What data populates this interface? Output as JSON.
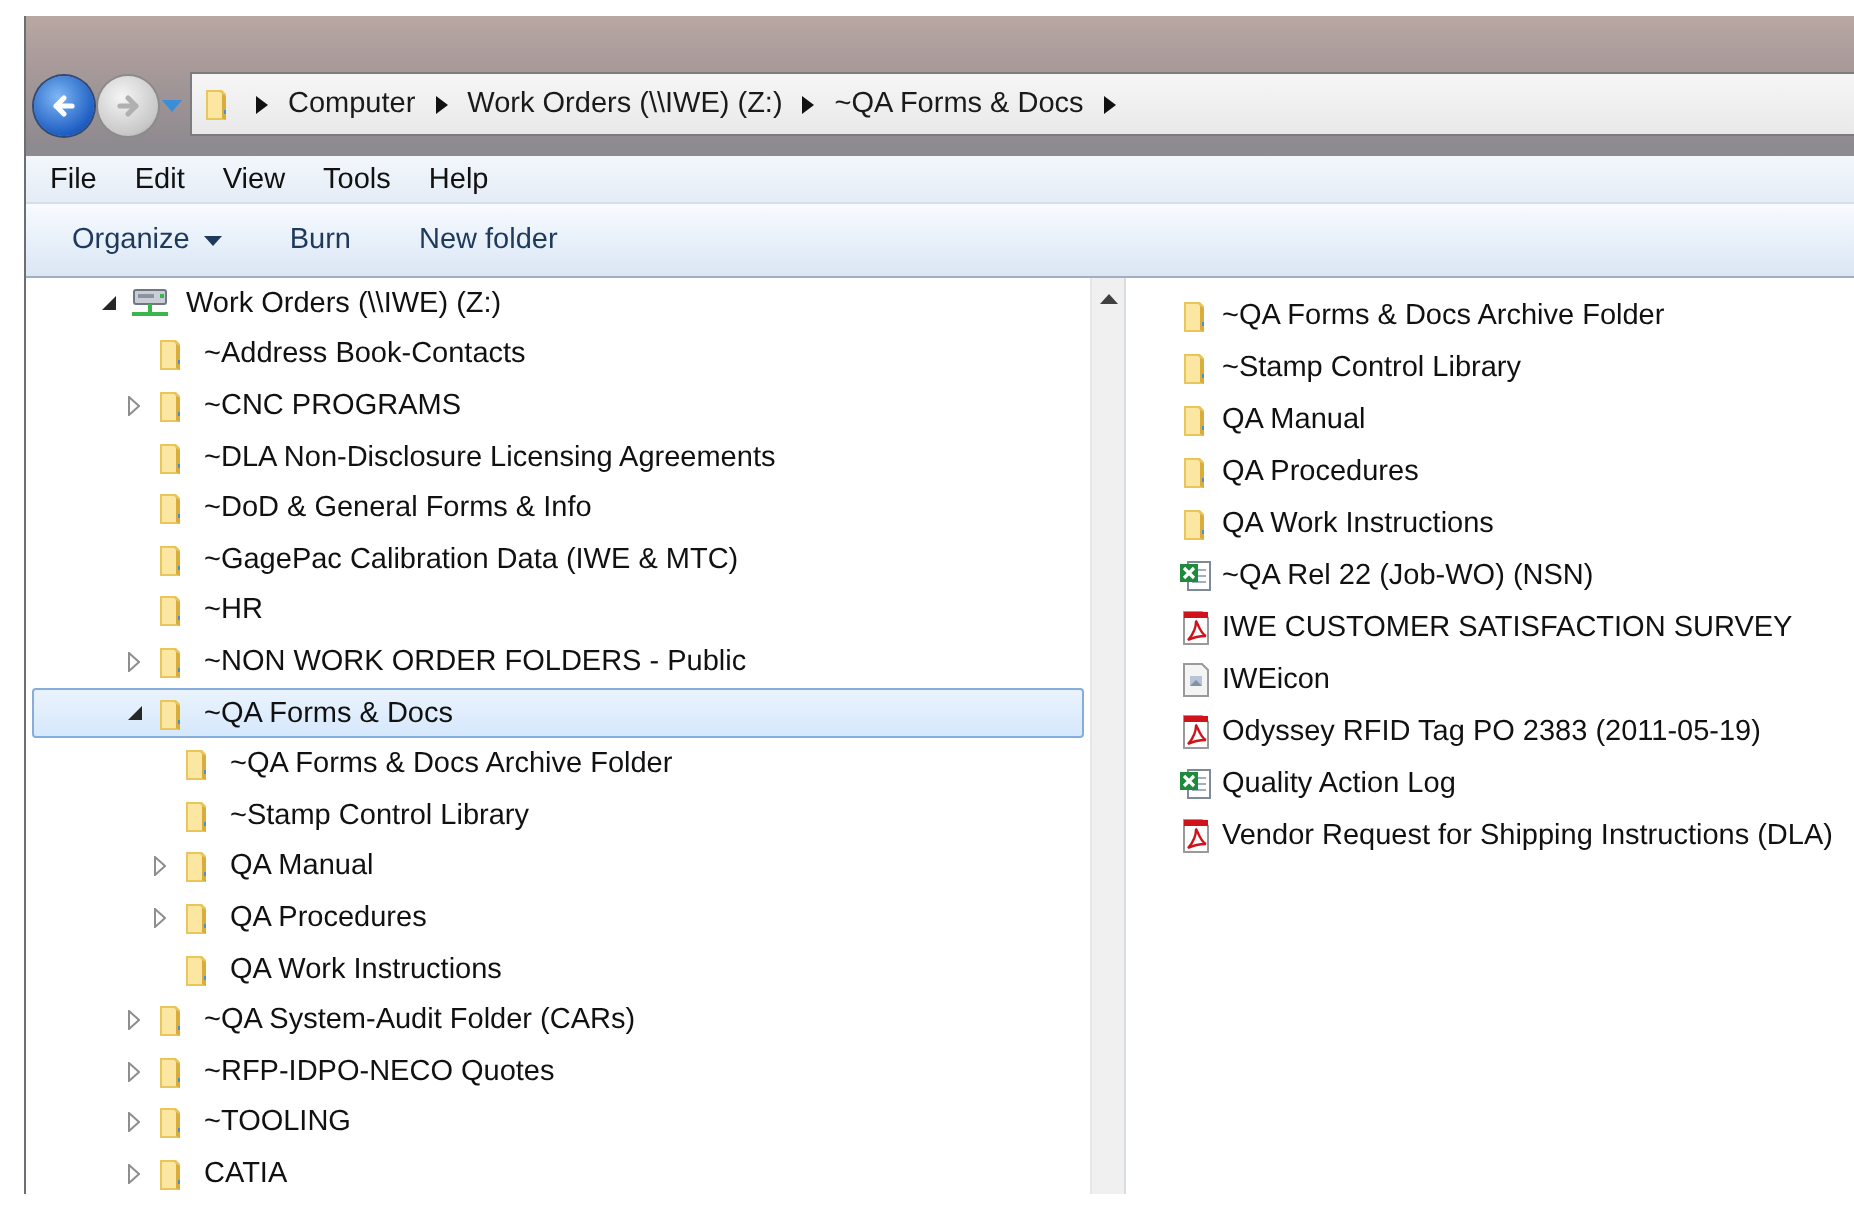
{
  "navigation_buttons": [
    {
      "kind": "back",
      "disabled": false
    },
    {
      "kind": "forward",
      "disabled": true
    }
  ],
  "address_bar": {
    "breadcrumbs": [
      "Computer",
      "Work Orders (\\\\IWE) (Z:)",
      "~QA Forms & Docs"
    ]
  },
  "menu_bar": [
    "File",
    "Edit",
    "View",
    "Tools",
    "Help"
  ],
  "toolbar": [
    {
      "label": "Organize",
      "kind": "dropdown"
    },
    {
      "label": "Burn",
      "kind": "button"
    },
    {
      "label": "New folder",
      "kind": "button"
    }
  ],
  "navigation_pane": {
    "items": [
      {
        "label": "Work Orders (\\\\IWE) (Z:)",
        "kind": "drive",
        "expanded": true,
        "selected": false,
        "children": [
          {
            "label": "~Address Book-Contacts",
            "kind": "folder",
            "selected": false
          },
          {
            "label": "~CNC PROGRAMS",
            "kind": "folder",
            "expanded": false,
            "selected": false
          },
          {
            "label": "~DLA Non-Disclosure Licensing Agreements",
            "kind": "folder",
            "selected": false
          },
          {
            "label": "~DoD & General Forms & Info",
            "kind": "folder",
            "selected": false
          },
          {
            "label": "~GagePac Calibration Data (IWE & MTC)",
            "kind": "folder",
            "selected": false
          },
          {
            "label": "~HR",
            "kind": "folder",
            "selected": false
          },
          {
            "label": "~NON WORK ORDER FOLDERS - Public",
            "kind": "folder",
            "expanded": false,
            "selected": false
          },
          {
            "label": "~QA Forms & Docs",
            "kind": "folder",
            "expanded": true,
            "selected": true,
            "children": [
              {
                "label": "~QA Forms & Docs Archive Folder",
                "kind": "folder",
                "selected": false
              },
              {
                "label": "~Stamp Control Library",
                "kind": "folder",
                "selected": false
              },
              {
                "label": "QA Manual",
                "kind": "folder",
                "expanded": false,
                "selected": false
              },
              {
                "label": "QA Procedures",
                "kind": "folder",
                "expanded": false,
                "selected": false
              },
              {
                "label": "QA Work Instructions",
                "kind": "folder",
                "selected": false
              }
            ]
          },
          {
            "label": "~QA System-Audit Folder (CARs)",
            "kind": "folder",
            "expanded": false,
            "selected": false
          },
          {
            "label": "~RFP-IDPO-NECO Quotes",
            "kind": "folder",
            "expanded": false,
            "selected": false
          },
          {
            "label": "~TOOLING",
            "kind": "folder",
            "expanded": false,
            "selected": false
          },
          {
            "label": "CATIA",
            "kind": "folder",
            "expanded": false,
            "selected": false
          }
        ]
      }
    ]
  },
  "files": [
    {
      "name": "~QA Forms & Docs Archive Folder",
      "kind": "folder"
    },
    {
      "name": "~Stamp Control Library",
      "kind": "folder"
    },
    {
      "name": "QA Manual",
      "kind": "folder"
    },
    {
      "name": "QA Procedures",
      "kind": "folder"
    },
    {
      "name": "QA Work Instructions",
      "kind": "folder"
    },
    {
      "name": "~QA Rel 22 (Job-WO) (NSN)",
      "kind": "spreadsheet"
    },
    {
      "name": "IWE CUSTOMER SATISFACTION SURVEY",
      "kind": "pdf"
    },
    {
      "name": "IWEicon",
      "kind": "image"
    },
    {
      "name": "Odyssey RFID Tag PO 2383 (2011-05-19)",
      "kind": "pdf"
    },
    {
      "name": "Quality Action Log",
      "kind": "spreadsheet"
    },
    {
      "name": "Vendor Request for Shipping Instructions (DLA)",
      "kind": "pdf"
    }
  ]
}
